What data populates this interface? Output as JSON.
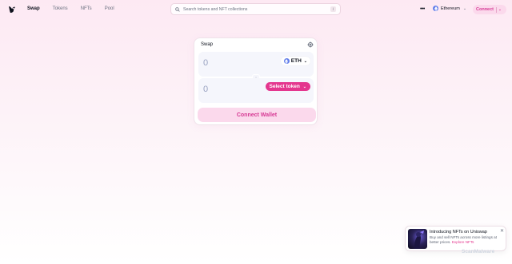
{
  "nav": {
    "links": [
      "Swap",
      "Tokens",
      "NFTs",
      "Pool"
    ],
    "active": "Swap",
    "search_placeholder": "Search tokens and NFT collections",
    "search_shortcut": "/",
    "more_label": "•••",
    "network": "Ethereum",
    "connect_label": "Connect"
  },
  "swap": {
    "title": "Swap",
    "input_amount": "0",
    "input_token": "ETH",
    "output_amount": "0",
    "select_token_label": "Select token",
    "connect_wallet_label": "Connect Wallet"
  },
  "toast": {
    "title": "Introducing NFTs on Uniswap",
    "body": "Buy and sell NFTs across more listings at better prices.",
    "link": "Explore NFTs"
  },
  "watermark": "ScanMalware",
  "colors": {
    "accent": "#e4368e",
    "accent_soft": "#fbd9ec",
    "eth": "#627eea"
  }
}
